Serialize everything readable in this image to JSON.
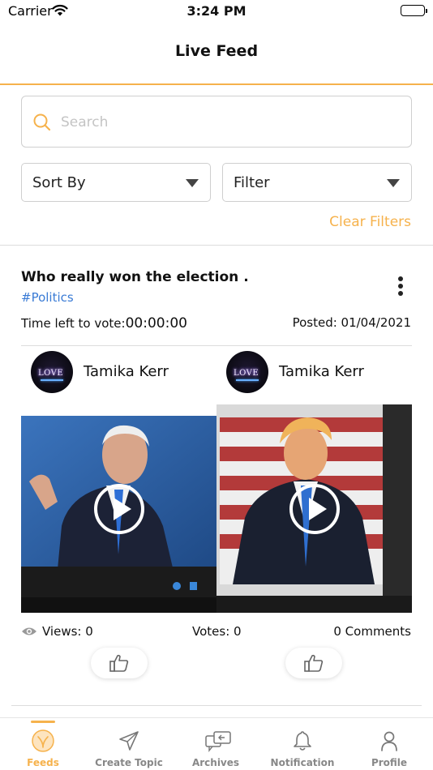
{
  "status_bar": {
    "carrier": "Carrier",
    "time": "3:24 PM"
  },
  "nav": {
    "title": "Live Feed"
  },
  "search": {
    "placeholder": "Search",
    "value": ""
  },
  "filters": {
    "sort_label": "Sort By",
    "filter_label": "Filter",
    "clear_label": "Clear Filters"
  },
  "post": {
    "title": "Who really won the election .",
    "tag": "#Politics",
    "time_left_label": "Time left to vote:",
    "time_left_value": "00:00:00",
    "posted": "Posted: 01/04/2021",
    "authors": [
      {
        "name": "Tamika Kerr",
        "avatar_text": "LOVE"
      },
      {
        "name": "Tamika Kerr",
        "avatar_text": "LOVE"
      }
    ],
    "views": "Views: 0",
    "votes": "Votes: 0",
    "comments": "0 Comments"
  },
  "tabs": [
    {
      "label": "Feeds",
      "icon": "feeds-icon",
      "active": true
    },
    {
      "label": "Create Topic",
      "icon": "send-icon",
      "active": false
    },
    {
      "label": "Archives",
      "icon": "archives-icon",
      "active": false
    },
    {
      "label": "Notification",
      "icon": "bell-icon",
      "active": false
    },
    {
      "label": "Profile",
      "icon": "person-icon",
      "active": false
    }
  ],
  "colors": {
    "accent": "#f6b24c",
    "tag": "#3a7bd5",
    "inactive_tab": "#888888"
  }
}
